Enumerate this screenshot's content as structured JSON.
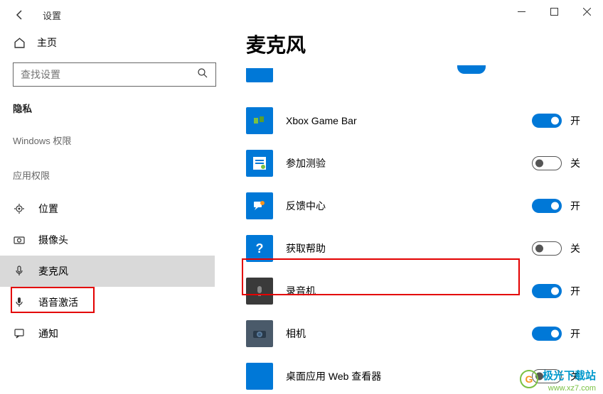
{
  "titlebar": {
    "title": "设置"
  },
  "sidebar": {
    "home": "主页",
    "search_placeholder": "查找设置",
    "section": "隐私",
    "subsection": "Windows 权限",
    "app_perm_label": "应用权限",
    "items": [
      {
        "label": "位置"
      },
      {
        "label": "摄像头"
      },
      {
        "label": "麦克风"
      },
      {
        "label": "语音激活"
      },
      {
        "label": "通知"
      }
    ]
  },
  "main": {
    "heading": "麦克风",
    "on_label": "开",
    "off_label": "关",
    "apps": [
      {
        "name": "Xbox Game Bar",
        "state": "on"
      },
      {
        "name": "参加测验",
        "state": "off"
      },
      {
        "name": "反馈中心",
        "state": "on"
      },
      {
        "name": "获取帮助",
        "state": "off"
      },
      {
        "name": "录音机",
        "state": "on"
      },
      {
        "name": "相机",
        "state": "on"
      },
      {
        "name": "桌面应用 Web 查看器",
        "state": "off"
      }
    ]
  },
  "watermark": {
    "name": "极光下载站",
    "url": "www.xz7.com"
  }
}
